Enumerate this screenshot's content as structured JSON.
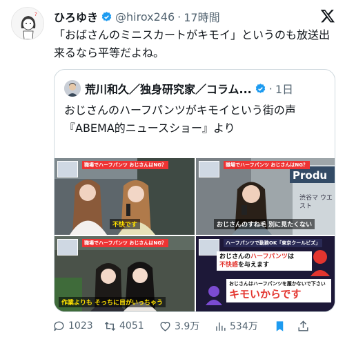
{
  "tweet": {
    "author_name": "ひろゆき",
    "handle": "@hirox246",
    "separator": "·",
    "time": "17時間",
    "text": "「おばさんのミニスカートがキモイ」というのも放送出来るなら平等だよね。"
  },
  "quote": {
    "author_name": "荒川和久／独身研究家／コラム...",
    "separator": "·",
    "time": "1日",
    "text_line1": "おじさんのハーフパンツがキモイという街の声",
    "text_line2": "『ABEMA的ニュースショー』より"
  },
  "images": [
    {
      "chip": "職場でハーフパンツ おじさんはNG？",
      "subtitle": "不快です",
      "pip_text": ""
    },
    {
      "chip": "職場でハーフパンツ おじさんはNG？",
      "subtitle": "おじさんのすね毛 別に見たくない",
      "sign_text": "Produ",
      "sign_sub": "渋谷マ ウエスト"
    },
    {
      "chip": "職場でハーフパンツ おじさんはNG？",
      "subtitle": "作業よりも そっちに目がいっちゃう"
    },
    {
      "chip": "ハーフパンツで勤務OK「東京クールビズ」",
      "caption1_pre": "おじさんの",
      "caption1_hl": "ハーフパンツ",
      "caption1_post": "は",
      "caption1_line2_pre": "",
      "caption1_hl2": "不快感",
      "caption1_post2": "を与えます",
      "caption2_line1": "おじさんはハーフパンツを履かないで下さい",
      "caption2_big": "キモいからです"
    }
  ],
  "actions": {
    "replies": "1023",
    "retweets": "4051",
    "likes": "3.9万",
    "views": "534万"
  },
  "colors": {
    "verified": "#1d9bf0",
    "secondary_text": "#536471",
    "border": "#cfd9de",
    "accent_red": "#e3352f"
  }
}
